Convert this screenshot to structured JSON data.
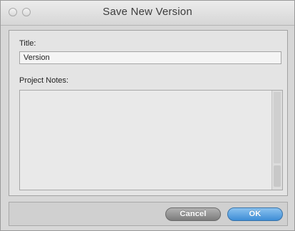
{
  "window": {
    "title": "Save New Version"
  },
  "form": {
    "title_label": "Title:",
    "title_value": "Version",
    "notes_label": "Project Notes:",
    "notes_value": ""
  },
  "buttons": {
    "cancel_label": "Cancel",
    "ok_label": "OK"
  },
  "colors": {
    "ok_button": "#3e8dd6",
    "cancel_button": "#7c7c7c"
  }
}
